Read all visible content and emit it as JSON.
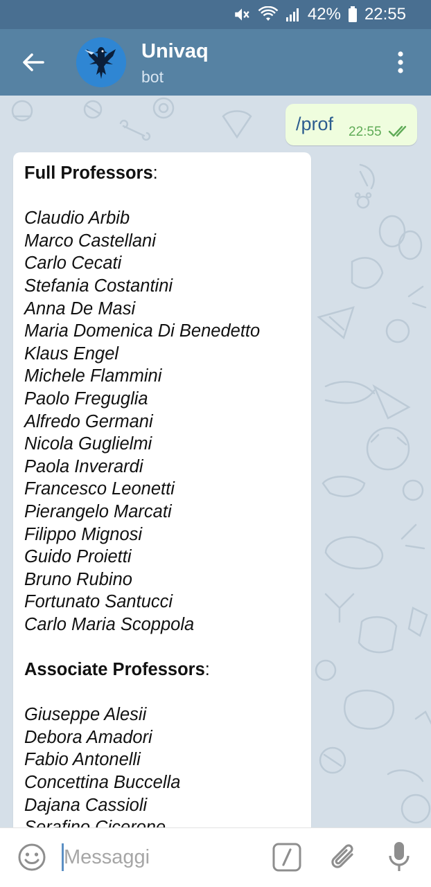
{
  "status_bar": {
    "battery_percent": "42%",
    "time": "22:55",
    "icons": [
      "mute-icon",
      "wifi-icon",
      "signal-icon",
      "battery-icon"
    ]
  },
  "header": {
    "title": "Univaq",
    "subtitle": "bot",
    "icons": [
      "back-arrow-icon",
      "avatar",
      "more-vert-icon"
    ]
  },
  "chat": {
    "outgoing": {
      "text": "/prof",
      "time": "22:55",
      "status": "read"
    },
    "incoming": {
      "full_heading": "Full Professors",
      "full_professors": [
        "Claudio Arbib",
        "Marco Castellani",
        "Carlo Cecati",
        "Stefania Costantini",
        "Anna De Masi",
        "Maria Domenica Di Benedetto",
        "Klaus Engel",
        "Michele Flammini",
        "Paolo Freguglia",
        "Alfredo Germani",
        "Nicola Guglielmi",
        "Paola Inverardi",
        "Francesco Leonetti",
        "Pierangelo Marcati",
        "Filippo Mignosi",
        "Guido Proietti",
        "Bruno Rubino",
        "Fortunato Santucci",
        "Carlo Maria Scoppola"
      ],
      "associate_heading": "Associate Professors",
      "associate_professors": [
        "Giuseppe Alesii",
        "Debora Amadori",
        "Fabio Antonelli",
        "Concettina Buccella",
        "Dajana Cassioli",
        "Serafino Cicerone"
      ]
    }
  },
  "input_bar": {
    "placeholder": "Messaggi",
    "value": "",
    "icons": [
      "emoji-icon",
      "bot-command-icon",
      "attach-icon",
      "mic-icon"
    ]
  },
  "colors": {
    "status_bar": "#496f91",
    "header": "#5682a3",
    "outgoing_bubble": "#effdde",
    "incoming_bubble": "#ffffff",
    "check_color": "#5fab57"
  }
}
